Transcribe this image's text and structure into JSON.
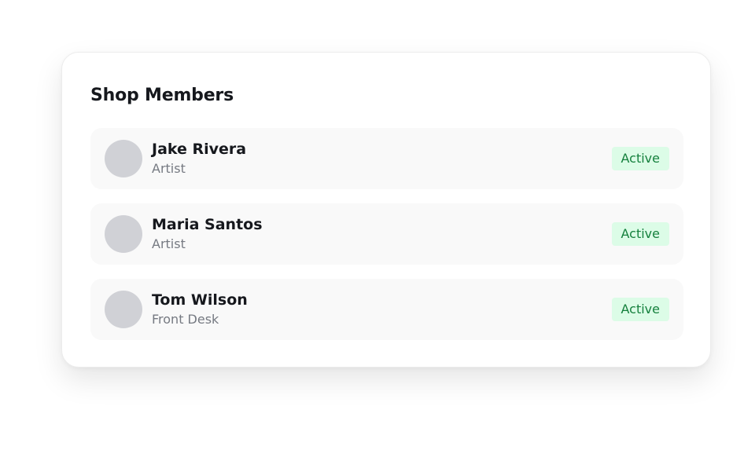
{
  "card": {
    "title": "Shop Members",
    "members": [
      {
        "name": "Jake Rivera",
        "role": "Artist",
        "status": "Active"
      },
      {
        "name": "Maria Santos",
        "role": "Artist",
        "status": "Active"
      },
      {
        "name": "Tom Wilson",
        "role": "Front Desk",
        "status": "Active"
      }
    ]
  },
  "colors": {
    "badge_bg": "#dcfce7",
    "badge_text": "#15803d",
    "avatar_placeholder": "#d0d1d6",
    "row_bg": "#f9f9f9"
  }
}
